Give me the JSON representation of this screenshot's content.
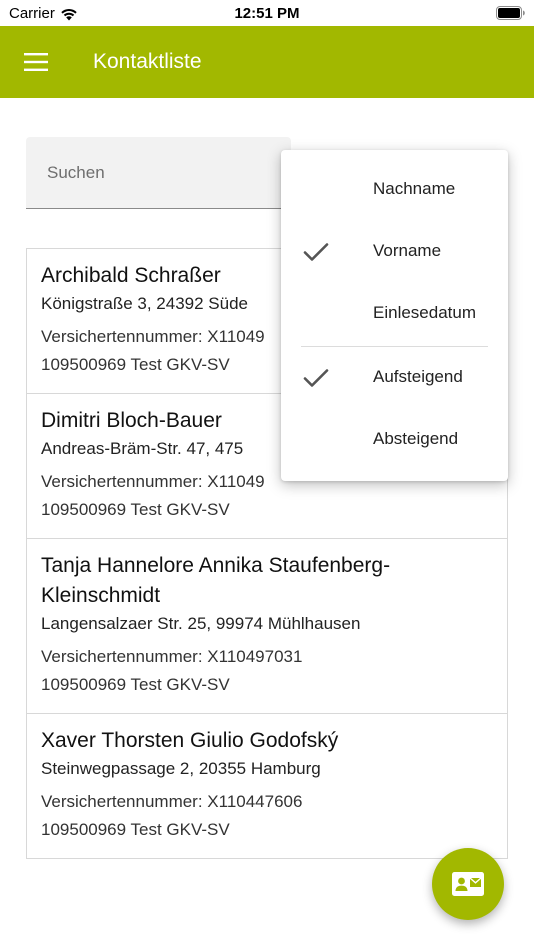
{
  "status_bar": {
    "carrier": "Carrier",
    "time": "12:51 PM",
    "wifi_icon": "wifi-icon",
    "battery_icon": "battery-icon"
  },
  "app_bar": {
    "title": "Kontaktliste",
    "menu_icon": "hamburger-menu-icon",
    "color": "#a2b800"
  },
  "search": {
    "placeholder": "Suchen",
    "value": ""
  },
  "sort_menu": {
    "field_options": [
      {
        "label": "Nachname",
        "selected": false
      },
      {
        "label": "Vorname",
        "selected": true
      },
      {
        "label": "Einlesedatum",
        "selected": false
      }
    ],
    "order_options": [
      {
        "label": "Aufsteigend",
        "selected": true
      },
      {
        "label": "Absteigend",
        "selected": false
      }
    ]
  },
  "contacts": [
    {
      "name": "Archibald Schraßer",
      "address": "Königstraße 3, 24392 Süde",
      "insurance_number": "Versichertennummer: X11049",
      "insurer": "109500969 Test GKV-SV"
    },
    {
      "name": "Dimitri Bloch-Bauer",
      "address": "Andreas-Bräm-Str. 47, 475",
      "insurance_number": "Versichertennummer: X11049",
      "insurer": "109500969 Test GKV-SV"
    },
    {
      "name": "Tanja Hannelore Annika Staufenberg-Kleinschmidt",
      "address": "Langensalzaer Str. 25, 99974 Mühlhausen",
      "insurance_number": "Versichertennummer: X110497031",
      "insurer": "109500969 Test GKV-SV"
    },
    {
      "name": "Xaver Thorsten Giulio Godofský",
      "address": "Steinwegpassage 2, 20355 Hamburg",
      "insurance_number": "Versichertennummer: X110447606",
      "insurer": "109500969 Test GKV-SV"
    }
  ],
  "fab": {
    "icon": "contact-card-icon",
    "color": "#a2b800"
  }
}
